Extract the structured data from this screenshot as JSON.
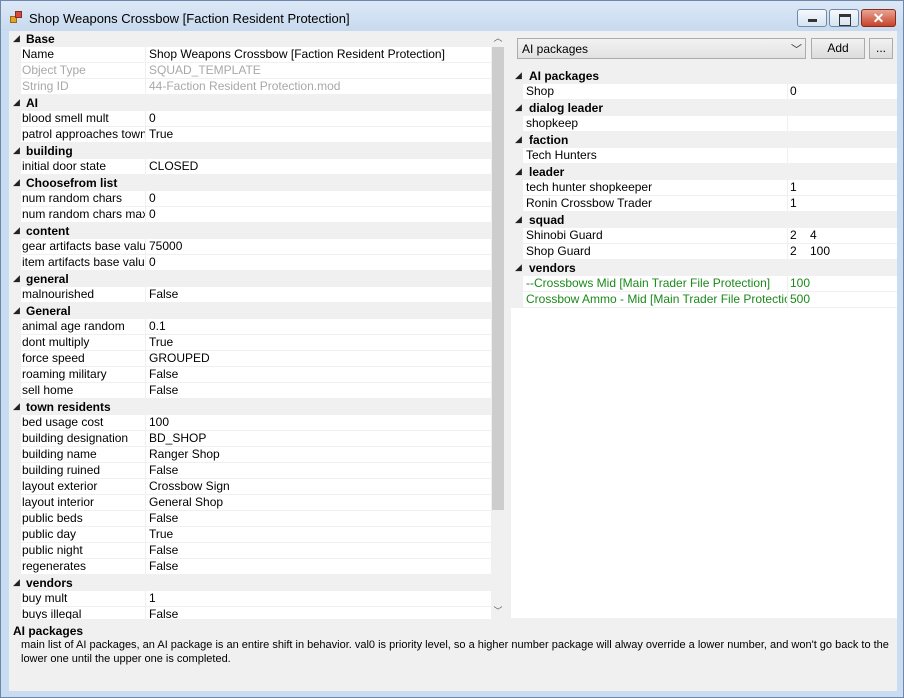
{
  "window": {
    "title": "Shop Weapons Crossbow [Faction Resident Protection]"
  },
  "left_grid": {
    "categories": [
      {
        "label": "Base",
        "rows": [
          {
            "name": "Name",
            "value": "Shop Weapons Crossbow [Faction Resident Protection]",
            "disabled": false
          },
          {
            "name": "Object Type",
            "value": "SQUAD_TEMPLATE",
            "disabled": true
          },
          {
            "name": "String ID",
            "value": "44-Faction Resident Protection.mod",
            "disabled": true
          }
        ]
      },
      {
        "label": "AI",
        "rows": [
          {
            "name": "blood smell mult",
            "value": "0",
            "disabled": false
          },
          {
            "name": "patrol approaches towns",
            "value": "True",
            "disabled": false
          }
        ]
      },
      {
        "label": "building",
        "rows": [
          {
            "name": "initial door state",
            "value": "CLOSED",
            "disabled": false
          }
        ]
      },
      {
        "label": "Choosefrom list",
        "rows": [
          {
            "name": "num random chars",
            "value": "0",
            "disabled": false
          },
          {
            "name": "num random chars max",
            "value": "0",
            "disabled": false
          }
        ]
      },
      {
        "label": "content",
        "rows": [
          {
            "name": "gear artifacts base value",
            "value": "75000",
            "disabled": false
          },
          {
            "name": "item artifacts base value",
            "value": "0",
            "disabled": false
          }
        ]
      },
      {
        "label": "general",
        "rows": [
          {
            "name": "malnourished",
            "value": "False",
            "disabled": false
          }
        ]
      },
      {
        "label": "General",
        "rows": [
          {
            "name": "animal age random",
            "value": "0.1",
            "disabled": false
          },
          {
            "name": "dont multiply",
            "value": "True",
            "disabled": false
          },
          {
            "name": "force speed",
            "value": "GROUPED",
            "disabled": false
          },
          {
            "name": "roaming military",
            "value": "False",
            "disabled": false
          },
          {
            "name": "sell home",
            "value": "False",
            "disabled": false
          }
        ]
      },
      {
        "label": "town residents",
        "rows": [
          {
            "name": "bed usage cost",
            "value": "100",
            "disabled": false
          },
          {
            "name": "building designation",
            "value": "BD_SHOP",
            "disabled": false
          },
          {
            "name": "building name",
            "value": "Ranger Shop",
            "disabled": false
          },
          {
            "name": "building ruined",
            "value": "False",
            "disabled": false
          },
          {
            "name": "layout exterior",
            "value": "Crossbow Sign",
            "disabled": false
          },
          {
            "name": "layout interior",
            "value": "General Shop",
            "disabled": false
          },
          {
            "name": "public beds",
            "value": "False",
            "disabled": false
          },
          {
            "name": "public day",
            "value": "True",
            "disabled": false
          },
          {
            "name": "public night",
            "value": "False",
            "disabled": false
          },
          {
            "name": "regenerates",
            "value": "False",
            "disabled": false
          }
        ]
      },
      {
        "label": "vendors",
        "rows": [
          {
            "name": "buy mult",
            "value": "1",
            "disabled": false
          },
          {
            "name": "buys illegal",
            "value": "False",
            "disabled": false
          }
        ]
      }
    ]
  },
  "right_panel": {
    "combo_value": "AI packages",
    "add_label": "Add",
    "more_label": "...",
    "categories": [
      {
        "label": "AI packages",
        "rows": [
          {
            "name": "Shop",
            "value": "0",
            "green": false
          }
        ]
      },
      {
        "label": "dialog leader",
        "rows": [
          {
            "name": "shopkeep",
            "value": "",
            "green": false
          }
        ]
      },
      {
        "label": "faction",
        "rows": [
          {
            "name": "Tech Hunters",
            "value": "",
            "green": false
          }
        ]
      },
      {
        "label": "leader",
        "rows": [
          {
            "name": "tech hunter shopkeeper",
            "value": "1",
            "green": false
          },
          {
            "name": "Ronin Crossbow Trader",
            "value": "1",
            "green": false
          }
        ]
      },
      {
        "label": "squad",
        "rows": [
          {
            "name": "Shinobi Guard",
            "value": "2    4",
            "green": false
          },
          {
            "name": "Shop Guard",
            "value": "2    100",
            "green": false
          }
        ]
      },
      {
        "label": "vendors",
        "rows": [
          {
            "name": "--Crossbows Mid [Main Trader File Protection]",
            "value": "100",
            "green": true
          },
          {
            "name": "Crossbow Ammo - Mid [Main Trader File Protection]",
            "value": "500",
            "green": true
          }
        ]
      }
    ]
  },
  "help": {
    "title": "AI packages",
    "description": "main list of AI packages, an AI package is an entire shift in behavior.  val0 is priority level, so a higher number package will alway override a lower number, and won't go back to the lower one until the upper one is completed."
  },
  "colors": {
    "title_bar": "#c9dcf1",
    "panel_bg": "#f0f0f0",
    "disabled_text": "#a8a8a8",
    "green_text": "#1a8a1a"
  }
}
